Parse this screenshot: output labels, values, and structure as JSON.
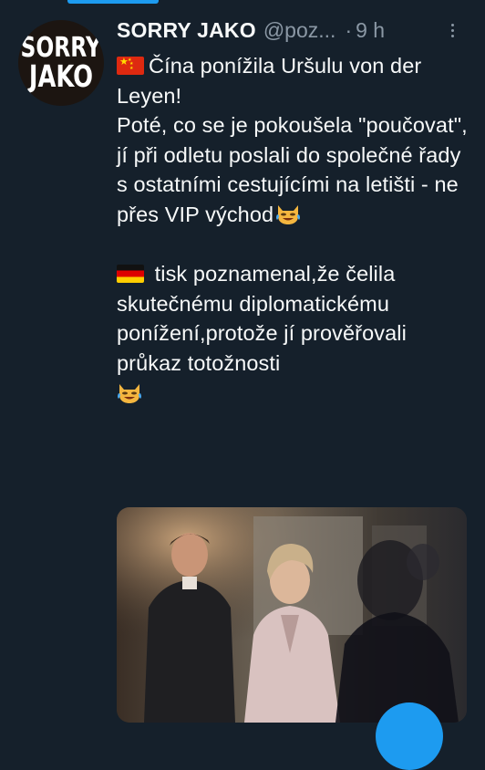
{
  "tweet": {
    "display_name": "SORRY JAKO",
    "handle": "@poz...",
    "separator": "·",
    "time": "9 h",
    "more_icon": "more-vertical-icon",
    "avatar": {
      "line1": "SORRY",
      "line2": "JAKO"
    },
    "text": {
      "line1": "Čína ponížila Uršulu von der Leyen!",
      "line2": "Poté, co se je pokoušela \"poučovat\", jí při odletu poslali do společné řady s ostatními cestujícími na letišti - ne přes VIP východ",
      "line3": " tisk poznamenal,že čelila skutečnému diplomatickému ponížení,protože jí prověřovali průkaz totožnosti"
    },
    "emoji": {
      "flag_first": "china-flag-icon",
      "flag_second": "germany-flag-icon",
      "cat": "cat-tears-of-joy-icon"
    },
    "media": {
      "type": "photo",
      "icon": "photo-thumbnail"
    }
  },
  "colors": {
    "background": "#15202b",
    "text": "#f7f9f9",
    "secondary": "#8b98a5",
    "accent": "#1d9bf0"
  }
}
